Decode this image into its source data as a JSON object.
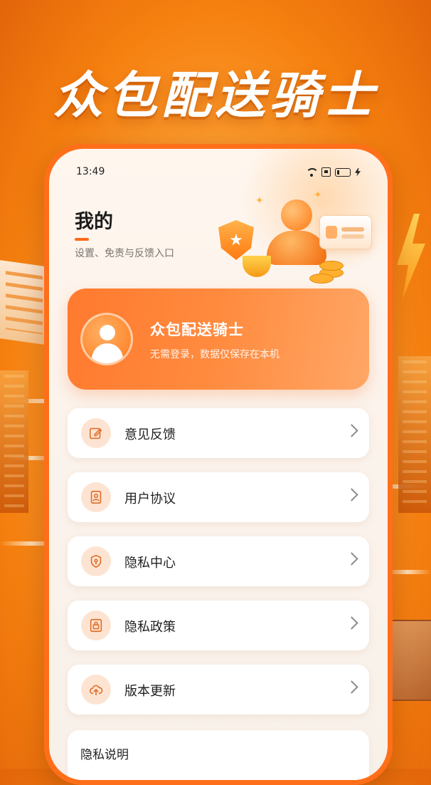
{
  "headline": "众包配送骑士",
  "status_bar": {
    "time": "13:49"
  },
  "page": {
    "title": "我的",
    "subtitle": "设置、免责与反馈入口"
  },
  "profile": {
    "name": "众包配送骑士",
    "description": "无需登录，数据仅保存在本机"
  },
  "menu": [
    {
      "label": "意见反馈",
      "icon": "edit-icon"
    },
    {
      "label": "用户协议",
      "icon": "document-icon"
    },
    {
      "label": "隐私中心",
      "icon": "shield-lock-icon"
    },
    {
      "label": "隐私政策",
      "icon": "policy-icon"
    },
    {
      "label": "版本更新",
      "icon": "cloud-upload-icon"
    }
  ],
  "privacy_note": {
    "title": "隐私说明"
  },
  "colors": {
    "accent": "#ff6f1a",
    "icon_bg": "#fde4d2",
    "icon_stroke": "#e2702c"
  }
}
